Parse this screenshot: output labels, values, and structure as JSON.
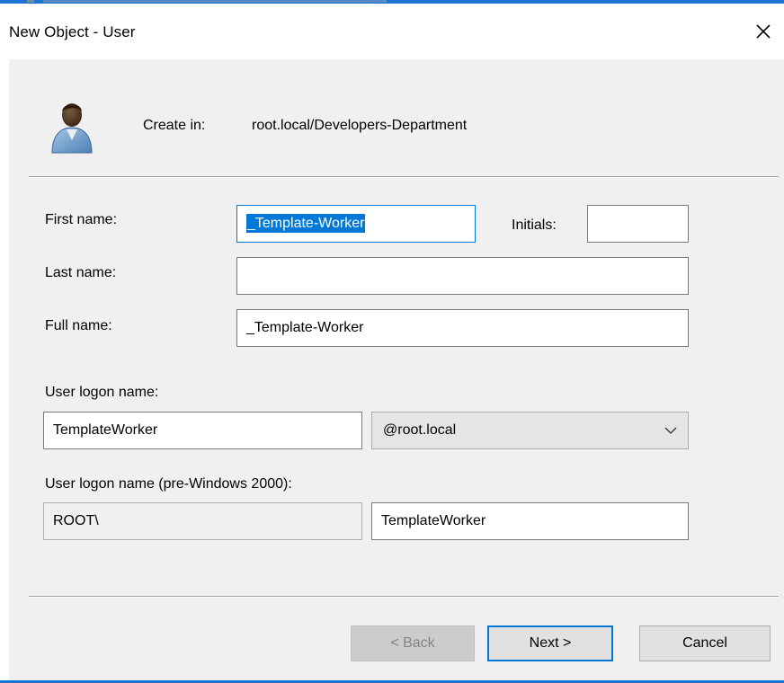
{
  "window": {
    "title": "New Object - User",
    "close_icon": "close-icon"
  },
  "header": {
    "icon": "user-icon",
    "create_in_label": "Create in:",
    "create_in_value": "root.local/Developers-Department"
  },
  "form": {
    "first_name_label": "First name:",
    "first_name_value": "_Template-Worker",
    "initials_label": "Initials:",
    "initials_value": "",
    "last_name_label": "Last name:",
    "last_name_value": "",
    "full_name_label": "Full name:",
    "full_name_value": "_Template-Worker",
    "logon_name_label": "User logon name:",
    "logon_name_value": "TemplateWorker",
    "logon_domain_value": "@root.local",
    "pre2000_label": "User logon name (pre-Windows 2000):",
    "pre2000_domain_value": "ROOT\\",
    "pre2000_name_value": "TemplateWorker"
  },
  "buttons": {
    "back_label": "< Back",
    "next_label": "Next >",
    "cancel_label": "Cancel"
  },
  "colors": {
    "accent": "#0078d7",
    "window_border": "#1b75d0",
    "dialog_background": "#f0f0f0"
  }
}
